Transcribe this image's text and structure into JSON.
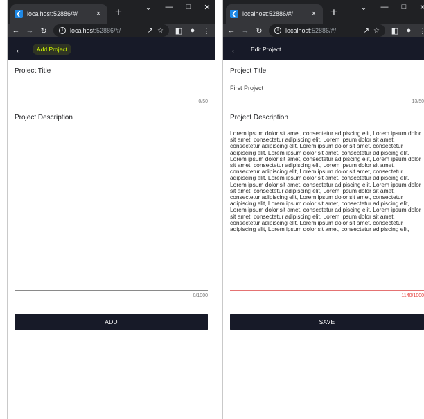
{
  "browser": {
    "tab_title": "localhost:52886/#/",
    "tab_close": "×",
    "new_tab": "+",
    "url_host": "localhost",
    "url_rest": ":52886/#/"
  },
  "left": {
    "appbar_title": "Add Project",
    "title_label": "Project Title",
    "title_value": "",
    "title_counter": "0/50",
    "description_label": "Project Description",
    "description_value": "",
    "description_counter": "0/1000",
    "button_label": "ADD"
  },
  "right": {
    "appbar_title": "Edit Project",
    "title_label": "Project Title",
    "title_value": "First Project",
    "title_counter": "13/50",
    "description_label": "Project Description",
    "description_value": "Lorem ipsum dolor sit amet, consectetur adipiscing elit, Lorem ipsum dolor sit amet, consectetur adipiscing elit, Lorem ipsum dolor sit amet, consectetur adipiscing elit, Lorem ipsum dolor sit amet, consectetur adipiscing elit, Lorem ipsum dolor sit amet, consectetur adipiscing elit, Lorem ipsum dolor sit amet, consectetur adipiscing elit, Lorem ipsum dolor sit amet, consectetur adipiscing elit, Lorem ipsum dolor sit amet, consectetur adipiscing elit, Lorem ipsum dolor sit amet, consectetur adipiscing elit, Lorem ipsum dolor sit amet, consectetur adipiscing elit, Lorem ipsum dolor sit amet, consectetur adipiscing elit, Lorem ipsum dolor sit amet, consectetur adipiscing elit, Lorem ipsum dolor sit amet, consectetur adipiscing elit, Lorem ipsum dolor sit amet, consectetur adipiscing elit, Lorem ipsum dolor sit amet, consectetur adipiscing elit, Lorem ipsum dolor sit amet, consectetur adipiscing elit, Lorem ipsum dolor sit amet, consectetur adipiscing elit, Lorem ipsum dolor sit amet, consectetur adipiscing elit, Lorem ipsum dolor sit amet, consectetur adipiscing elit, Lorem ipsum dolor sit amet, consectetur adipiscing elit,",
    "description_counter": "1140/1000",
    "button_label": "SAVE"
  },
  "icons": {
    "back": "back-arrow-icon",
    "reload": "reload-icon",
    "forward": "forward-arrow-icon",
    "info": "info-icon",
    "share": "share-icon",
    "bookmark": "star-icon",
    "sidepanel": "side-panel-icon",
    "profile": "profile-icon",
    "menu": "kebab-menu-icon"
  },
  "colors": {
    "appbar": "#171a28",
    "button": "#171a28",
    "error": "#e53935",
    "highlight_text": "#d7ff00"
  }
}
